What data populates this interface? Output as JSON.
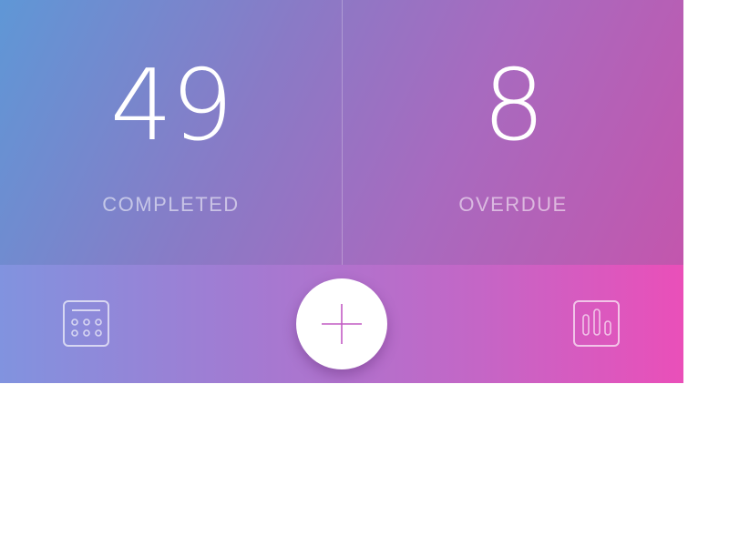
{
  "stats": {
    "completed": {
      "value": "49",
      "label": "COMPLETED"
    },
    "overdue": {
      "value": "8",
      "label": "OVERDUE"
    }
  },
  "toolbar": {
    "left_icon": "calendar-icon",
    "center_icon": "plus-icon",
    "right_icon": "bar-chart-icon"
  },
  "colors": {
    "stats_gradient_start": "#5f97d6",
    "stats_gradient_end": "#c356ad",
    "toolbar_gradient_start": "#8193df",
    "toolbar_gradient_end": "#ea4fb9",
    "fab_background": "#ffffff",
    "plus_accent": "#c25bc4"
  }
}
